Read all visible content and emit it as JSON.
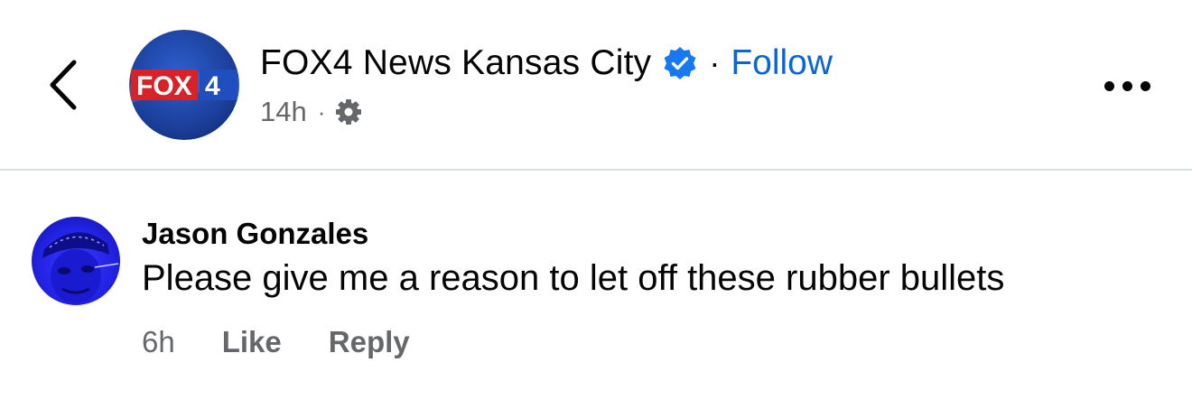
{
  "post_header": {
    "back_icon": "chevron-left-icon",
    "page_name": "FOX4 News Kansas City",
    "verified_icon": "verified-badge-icon",
    "separator": "·",
    "follow_label": "Follow",
    "timestamp": "14h",
    "meta_separator": "·",
    "audience_icon": "gear-icon",
    "more_icon": "more-options-icon",
    "avatar_logo_text": "FOX",
    "avatar_logo_number": "4",
    "colors": {
      "follow": "#0a66d8",
      "verified": "#1877f2",
      "avatar_blue": "#1b3f9a"
    }
  },
  "comment": {
    "author": "Jason Gonzales",
    "text": "Please give me a reason to let off these rubber bullets",
    "time": "6h",
    "like_label": "Like",
    "reply_label": "Reply",
    "avatar_color": "#2b2bf0"
  }
}
